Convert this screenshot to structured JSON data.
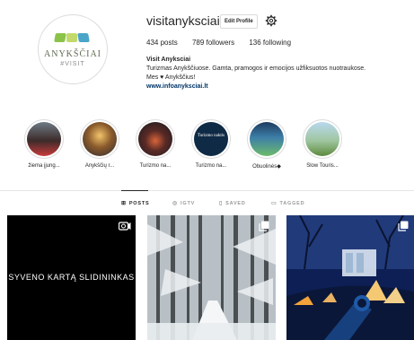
{
  "profile": {
    "username": "visitanyksciai",
    "edit_button_label": "Edit Profile",
    "logo_name": "ANYKŠČIAI",
    "logo_tag": "#VISIT",
    "stats": {
      "posts": "434 posts",
      "followers": "789 followers",
      "following": "136 following"
    },
    "bio": {
      "name": "Visit Anyksciai",
      "line1": "Turizmas Anykščiuose. Gamta, pramogos ir emocijos užfiksuotos nuotraukose.",
      "line2": "Mes ♥ Anykščius!",
      "link": "www.infoanyksciai.lt"
    }
  },
  "highlights": [
    {
      "label": "žiema įjung..."
    },
    {
      "label": "Anykščių r..."
    },
    {
      "label": "Turizmo na..."
    },
    {
      "label": "Turizmo na..."
    },
    {
      "label": "Obuolinės◆"
    },
    {
      "label": "Slow Touris..."
    }
  ],
  "highlight_inner_text": "Turizmo naktis",
  "tabs": [
    {
      "label": "POSTS",
      "icon": "grid-icon"
    },
    {
      "label": "IGTV",
      "icon": "igtv-icon"
    },
    {
      "label": "SAVED",
      "icon": "bookmark-icon"
    },
    {
      "label": "TAGGED",
      "icon": "tag-icon"
    }
  ],
  "posts": [
    {
      "overlay_text": "SYVENO KARTĄ SLIDININKAS",
      "type_icon": "video-icon"
    },
    {
      "type_icon": "multi-photo-icon"
    },
    {
      "type_icon": "multi-photo-icon"
    }
  ],
  "colors": {
    "text": "#262626",
    "link": "#003569",
    "border": "#dbdbdb",
    "muted": "#999999"
  }
}
